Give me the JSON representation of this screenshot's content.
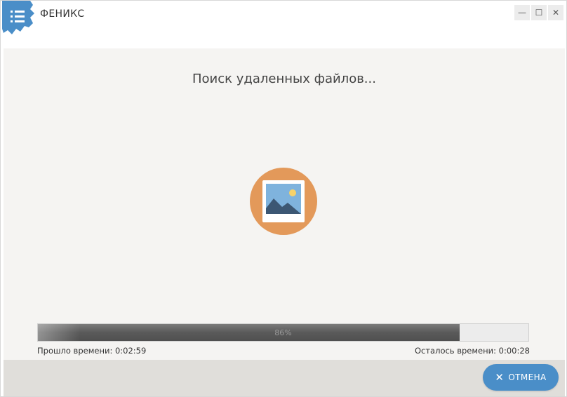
{
  "app": {
    "title": "ФЕНИКС"
  },
  "window_controls": {
    "minimize": "—",
    "maximize": "☐",
    "close": "✕"
  },
  "scan": {
    "status_title": "Поиск удаленных файлов...",
    "progress_percent": 86,
    "progress_label": "86%",
    "elapsed": "Прошло времени: 0:02:59",
    "remaining": "Осталось времени: 0:00:28"
  },
  "footer": {
    "cancel_label": "ОТМЕНА",
    "cancel_icon": "✕"
  },
  "colors": {
    "accent": "#4a8ec8",
    "icon_circle": "#e3995a",
    "background": "#f5f4f2"
  }
}
